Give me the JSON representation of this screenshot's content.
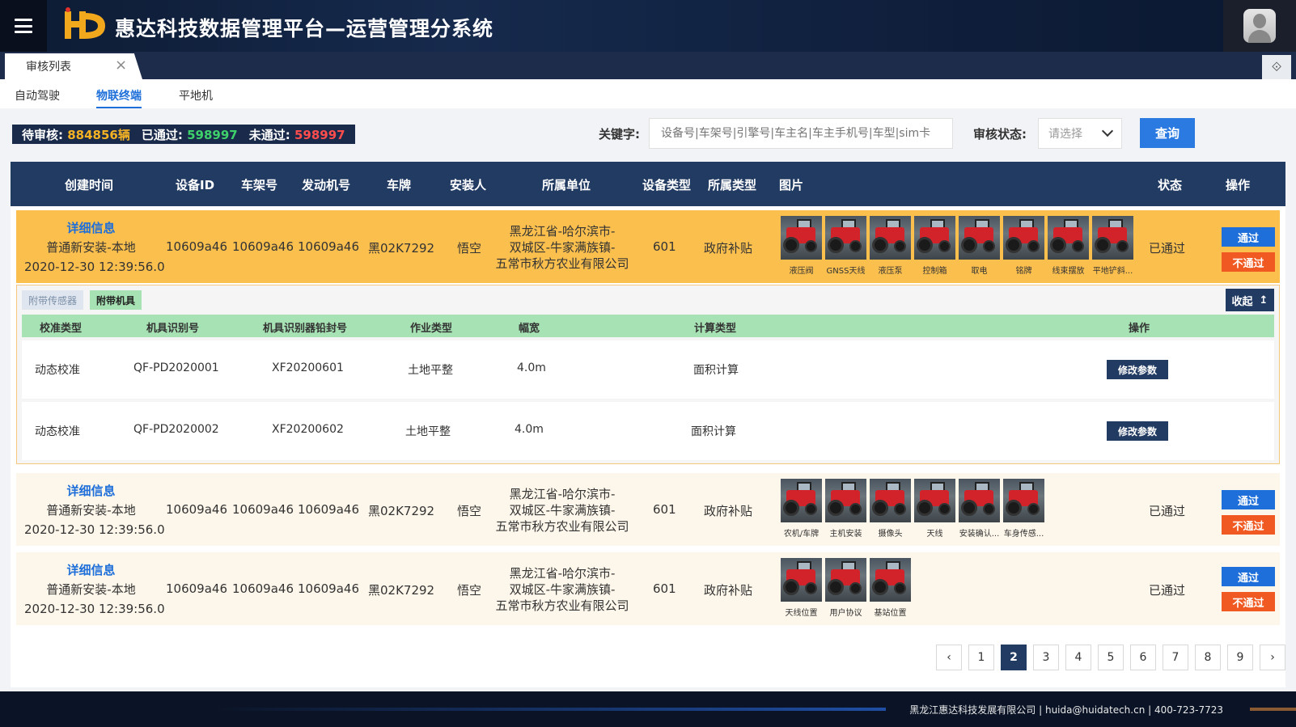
{
  "header": {
    "title": "惠达科技数据管理平台—运营管理分系统",
    "logo_text": "HD"
  },
  "tabs": [
    {
      "label": "审核列表"
    }
  ],
  "subnav": [
    "自动驾驶",
    "物联终端",
    "平地机"
  ],
  "summary": {
    "pending_label": "待审核:",
    "pending_value": "884856辆",
    "passed_label": "已通过:",
    "passed_value": "598997",
    "failed_label": "未通过:",
    "failed_value": "598997"
  },
  "search": {
    "keyword_label": "关键字:",
    "keyword_placeholder": "设备号|车架号|引擎号|车主名|车主手机号|车型|sim卡",
    "status_label": "审核状态:",
    "status_placeholder": "请选择",
    "query_label": "查询"
  },
  "table": {
    "headers": [
      "创建时间",
      "设备ID",
      "车架号",
      "发动机号",
      "车牌",
      "安装人",
      "所属单位",
      "设备类型",
      "所属类型",
      "图片",
      "状态",
      "操作"
    ],
    "rows": [
      {
        "detail": "详细信息",
        "install_type": "普通新安装-本地",
        "created": "2020-12-30 12:39:56.0",
        "device_id": "10609a46",
        "frame": "10609a46",
        "engine": "10609a46",
        "plate": "黑02K7292",
        "installer": "悟空",
        "unit": [
          "黑龙江省-哈尔滨市-",
          "双城区-牛家满族镇-",
          "五常市秋方农业有限公司"
        ],
        "device_type": "601",
        "owner_type": "政府补贴",
        "images": [
          "液压阀",
          "GNSS天线",
          "液压泵",
          "控制箱",
          "取电",
          "铭牌",
          "线束摆放",
          "平地铲斜..."
        ],
        "status": "已通过",
        "pass_label": "通过",
        "fail_label": "不通过"
      },
      {
        "detail": "详细信息",
        "install_type": "普通新安装-本地",
        "created": "2020-12-30 12:39:56.0",
        "device_id": "10609a46",
        "frame": "10609a46",
        "engine": "10609a46",
        "plate": "黑02K7292",
        "installer": "悟空",
        "unit": [
          "黑龙江省-哈尔滨市-",
          "双城区-牛家满族镇-",
          "五常市秋方农业有限公司"
        ],
        "device_type": "601",
        "owner_type": "政府补贴",
        "images": [
          "农机/车牌",
          "主机安装",
          "摄像头",
          "天线",
          "安装确认...",
          "车身传感..."
        ],
        "status": "已通过",
        "pass_label": "通过",
        "fail_label": "不通过"
      },
      {
        "detail": "详细信息",
        "install_type": "普通新安装-本地",
        "created": "2020-12-30 12:39:56.0",
        "device_id": "10609a46",
        "frame": "10609a46",
        "engine": "10609a46",
        "plate": "黑02K7292",
        "installer": "悟空",
        "unit": [
          "黑龙江省-哈尔滨市-",
          "双城区-牛家满族镇-",
          "五常市秋方农业有限公司"
        ],
        "device_type": "601",
        "owner_type": "政府补贴",
        "images": [
          "天线位置",
          "用户协议",
          "基站位置"
        ],
        "status": "已通过",
        "pass_label": "通过",
        "fail_label": "不通过"
      }
    ]
  },
  "expand": {
    "tabs": [
      "附带传感器",
      "附带机具"
    ],
    "collapse_label": "收起",
    "headers": [
      "校准类型",
      "机具识别号",
      "机具识别器铅封号",
      "作业类型",
      "幅宽",
      "计算类型",
      "操作"
    ],
    "rows": [
      {
        "calib": "动态校准",
        "tool_id": "QF-PD2020001",
        "seal": "XF20200601",
        "work": "土地平整",
        "width": "4.0m",
        "calc": "面积计算",
        "action": "修改参数"
      },
      {
        "calib": "动态校准",
        "tool_id": "QF-PD2020002",
        "seal": "XF20200602",
        "work": "土地平整",
        "width": "4.0m",
        "calc": "面积计算",
        "action": "修改参数"
      }
    ]
  },
  "pagination": {
    "prev": "‹",
    "pages": [
      "1",
      "2",
      "3",
      "4",
      "5",
      "6",
      "7",
      "8",
      "9"
    ],
    "current": "2",
    "next": "›"
  },
  "footer": {
    "text": "黑龙江惠达科技发展有限公司 | huida@huidatech.cn | 400-723-7723"
  },
  "colors": {
    "header_bg": "#0d1b33",
    "table_head": "#223b63",
    "highlight_row": "#fbbf4e",
    "accent_blue": "#1e6fd9",
    "reject_orange": "#f05a22",
    "sub_head_green": "#a6e2b3"
  }
}
